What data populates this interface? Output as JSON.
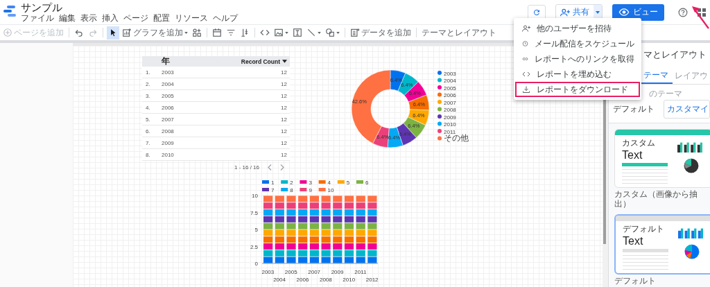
{
  "app": {
    "title": "サンプル",
    "menu": [
      "ファイル",
      "編集",
      "表示",
      "挿入",
      "ページ",
      "配置",
      "リソース",
      "ヘルプ"
    ]
  },
  "header_actions": {
    "share_label": "共有",
    "view_label": "ビュー"
  },
  "toolbar": [
    {
      "kind": "addpage",
      "label": "ページを追加",
      "disabled": true,
      "selected": false
    },
    {
      "kind": "separator"
    },
    {
      "kind": "undo",
      "disabled": false,
      "selected": false
    },
    {
      "kind": "redo",
      "disabled": true,
      "selected": false
    },
    {
      "kind": "separator"
    },
    {
      "kind": "select",
      "disabled": false,
      "selected": true
    },
    {
      "kind": "addchart",
      "label": "グラフを追加",
      "disabled": false,
      "selected": false
    },
    {
      "kind": "community",
      "disabled": false,
      "selected": false
    },
    {
      "kind": "separator"
    },
    {
      "kind": "date",
      "disabled": false,
      "selected": false
    },
    {
      "kind": "filter",
      "disabled": false,
      "selected": false
    },
    {
      "kind": "control",
      "disabled": false,
      "selected": false
    },
    {
      "kind": "separator"
    },
    {
      "kind": "code",
      "disabled": false,
      "selected": false
    },
    {
      "kind": "image",
      "disabled": false,
      "selected": false
    },
    {
      "kind": "text",
      "disabled": false,
      "selected": false
    },
    {
      "kind": "line",
      "disabled": false,
      "selected": false
    },
    {
      "kind": "shape",
      "disabled": false,
      "selected": false
    },
    {
      "kind": "separator"
    },
    {
      "kind": "adddata",
      "label": "データを追加",
      "disabled": false,
      "selected": false
    },
    {
      "kind": "separator"
    },
    {
      "kind": "theme",
      "label": "テーマとレイアウト",
      "disabled": false,
      "selected": false
    }
  ],
  "share_menu": [
    {
      "kind": "invite",
      "label": "他のユーザーを招待",
      "highlighted": false
    },
    {
      "kind": "schedule",
      "label": "メール配信をスケジュール",
      "highlighted": false
    },
    {
      "kind": "link",
      "label": "レポートへのリンクを取得",
      "highlighted": false
    },
    {
      "kind": "embed",
      "label": "レポートを埋め込む",
      "highlighted": false
    },
    {
      "kind": "download",
      "label": "レポートをダウンロード",
      "highlighted": true
    }
  ],
  "table": {
    "columns": [
      {
        "label": "年",
        "sorted": false
      },
      {
        "label": "Record Count",
        "sorted": true
      }
    ],
    "rows": [
      {
        "index": "1.",
        "year": "2003",
        "count": "12"
      },
      {
        "index": "2.",
        "year": "2004",
        "count": "12"
      },
      {
        "index": "3.",
        "year": "2005",
        "count": "12"
      },
      {
        "index": "4.",
        "year": "2006",
        "count": "12"
      },
      {
        "index": "5.",
        "year": "2007",
        "count": "12"
      },
      {
        "index": "6.",
        "year": "2008",
        "count": "12"
      },
      {
        "index": "7.",
        "year": "2009",
        "count": "12"
      },
      {
        "index": "8.",
        "year": "2010",
        "count": "12"
      }
    ],
    "pagination": "1 - 16 / 16"
  },
  "donut": {
    "chart_data": {
      "type": "donut",
      "categories": [
        "2003",
        "2004",
        "2005",
        "2006",
        "2007",
        "2008",
        "2009",
        "2010",
        "2011",
        "その他"
      ],
      "values": [
        6.4,
        6.4,
        6.4,
        6.4,
        6.4,
        6.4,
        6.4,
        6.4,
        6.4,
        42.6
      ],
      "value_labels": [
        "6.4%",
        "6.4%",
        "6.4%",
        "6.4%",
        "6.4%",
        "6.4%",
        "6.4%",
        "6.4%",
        "6.4%",
        "42.6%"
      ],
      "legend": "right"
    }
  },
  "bars": {
    "chart_data": {
      "type": "bar",
      "stacked": true,
      "categories": [
        "2003",
        "2004",
        "2005",
        "2006",
        "2007",
        "2008",
        "2009",
        "2010",
        "2011",
        "2012"
      ],
      "ylim": [
        0,
        10
      ],
      "yticks": [
        0,
        2.5,
        5,
        7.5,
        10
      ],
      "legend": "top",
      "series": [
        {
          "name": "1",
          "color": "#0072f0",
          "values": [
            1,
            1,
            1,
            1,
            1,
            1,
            1,
            1,
            1,
            1
          ]
        },
        {
          "name": "2",
          "color": "#00b6cb",
          "values": [
            1,
            1,
            1,
            1,
            1,
            1,
            1,
            1,
            1,
            1
          ]
        },
        {
          "name": "3",
          "color": "#f10096",
          "values": [
            1,
            1,
            1,
            1,
            1,
            1,
            1,
            1,
            1,
            1
          ]
        },
        {
          "name": "4",
          "color": "#f66d00",
          "values": [
            1,
            1,
            1,
            1,
            1,
            1,
            1,
            1,
            1,
            1
          ]
        },
        {
          "name": "5",
          "color": "#ffa800",
          "values": [
            1,
            1,
            1,
            1,
            1,
            1,
            1,
            1,
            1,
            1
          ]
        },
        {
          "name": "6",
          "color": "#7cb342",
          "values": [
            1,
            1,
            1,
            1,
            1,
            1,
            1,
            1,
            1,
            1
          ]
        },
        {
          "name": "7",
          "color": "#5e35b1",
          "values": [
            1,
            1,
            1,
            1,
            1,
            1,
            1,
            1,
            1,
            1
          ]
        },
        {
          "name": "8",
          "color": "#03a9f4",
          "values": [
            1,
            1,
            1,
            1,
            1,
            1,
            1,
            1,
            1,
            1
          ]
        },
        {
          "name": "9",
          "color": "#ec407a",
          "values": [
            1,
            1,
            1,
            1,
            1,
            1,
            1,
            1,
            1,
            1
          ]
        },
        {
          "name": "10",
          "color": "#ff7043",
          "values": [
            1,
            1,
            1,
            1,
            1,
            1,
            1,
            1,
            1,
            1
          ]
        }
      ]
    }
  },
  "panel": {
    "title": "マとレイアウト",
    "tabs": [
      {
        "label": "テーマ",
        "selected": true
      },
      {
        "label": "レイアウ",
        "selected": false
      }
    ],
    "current_theme_label": "のテーマ",
    "current_theme": "デフォルト",
    "customize_button": "カスタマイ",
    "themes": [
      {
        "name": "カスタム（画像から抽出）",
        "sample_title": "カスタム",
        "sample_text": "Text",
        "color": "#26c6a8",
        "selected": false
      },
      {
        "name": "デフォルト",
        "sample_title": "デフォルト",
        "sample_text": "Text",
        "color": "#e0e0e0",
        "selected": true
      }
    ]
  }
}
